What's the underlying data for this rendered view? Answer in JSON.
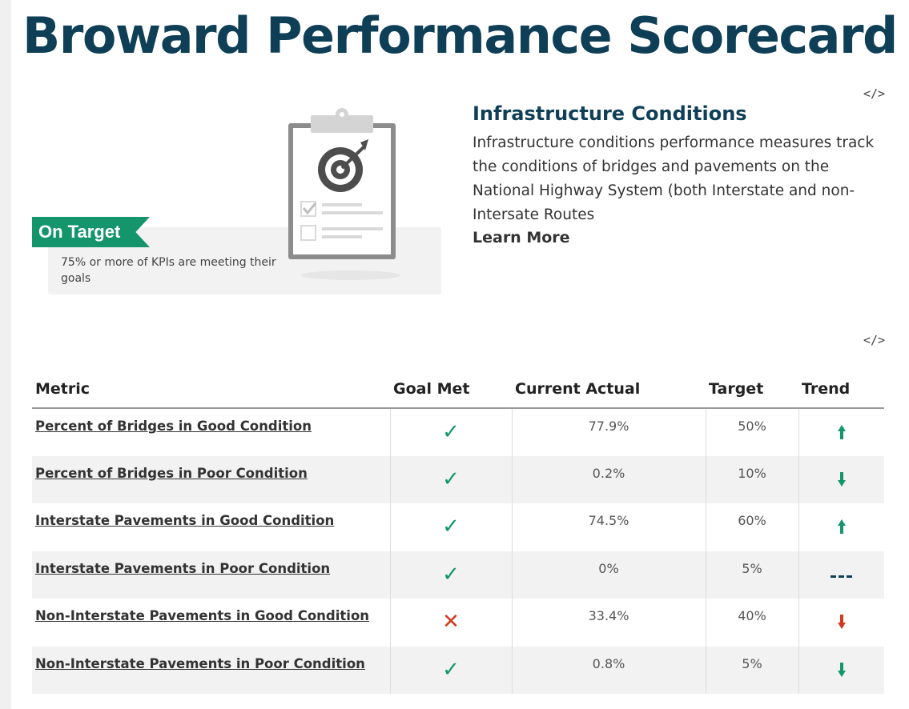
{
  "page": {
    "title": "Broward Performance Scorecard"
  },
  "embed": {
    "glyph": "</>"
  },
  "status": {
    "label": "On Target",
    "description": "75% or more of KPIs are meeting their goals",
    "color": "#14956b"
  },
  "section": {
    "title": "Infrastructure Conditions",
    "description": "Infrastructure conditions performance measures track the conditions of bridges and pavements on the National Highway System (both Interstate and non-Intersate Routes",
    "learn_more": "Learn More"
  },
  "table": {
    "headers": {
      "metric": "Metric",
      "goal_met": "Goal Met",
      "current_actual": "Current Actual",
      "target": "Target",
      "trend": "Trend"
    },
    "rows": [
      {
        "metric": "Percent of Bridges in Good Condition",
        "goal_met": "yes",
        "current_actual": "77.9%",
        "target": "50%",
        "trend": "up"
      },
      {
        "metric": "Percent of Bridges in Poor Condition",
        "goal_met": "yes",
        "current_actual": "0.2%",
        "target": "10%",
        "trend": "down-good"
      },
      {
        "metric": "Interstate Pavements in Good Condition",
        "goal_met": "yes",
        "current_actual": "74.5%",
        "target": "60%",
        "trend": "up"
      },
      {
        "metric": "Interstate Pavements in Poor Condition",
        "goal_met": "yes",
        "current_actual": "0%",
        "target": "5%",
        "trend": "flat"
      },
      {
        "metric": "Non-Interstate Pavements in Good Condition",
        "goal_met": "no",
        "current_actual": "33.4%",
        "target": "40%",
        "trend": "down-bad"
      },
      {
        "metric": "Non-Interstate Pavements in Poor Condition",
        "goal_met": "yes",
        "current_actual": "0.8%",
        "target": "5%",
        "trend": "down-good"
      }
    ]
  },
  "colors": {
    "met": "#14956b",
    "not_met": "#d13a1e",
    "title": "#0f3f57",
    "flat": "#0f3f57"
  }
}
